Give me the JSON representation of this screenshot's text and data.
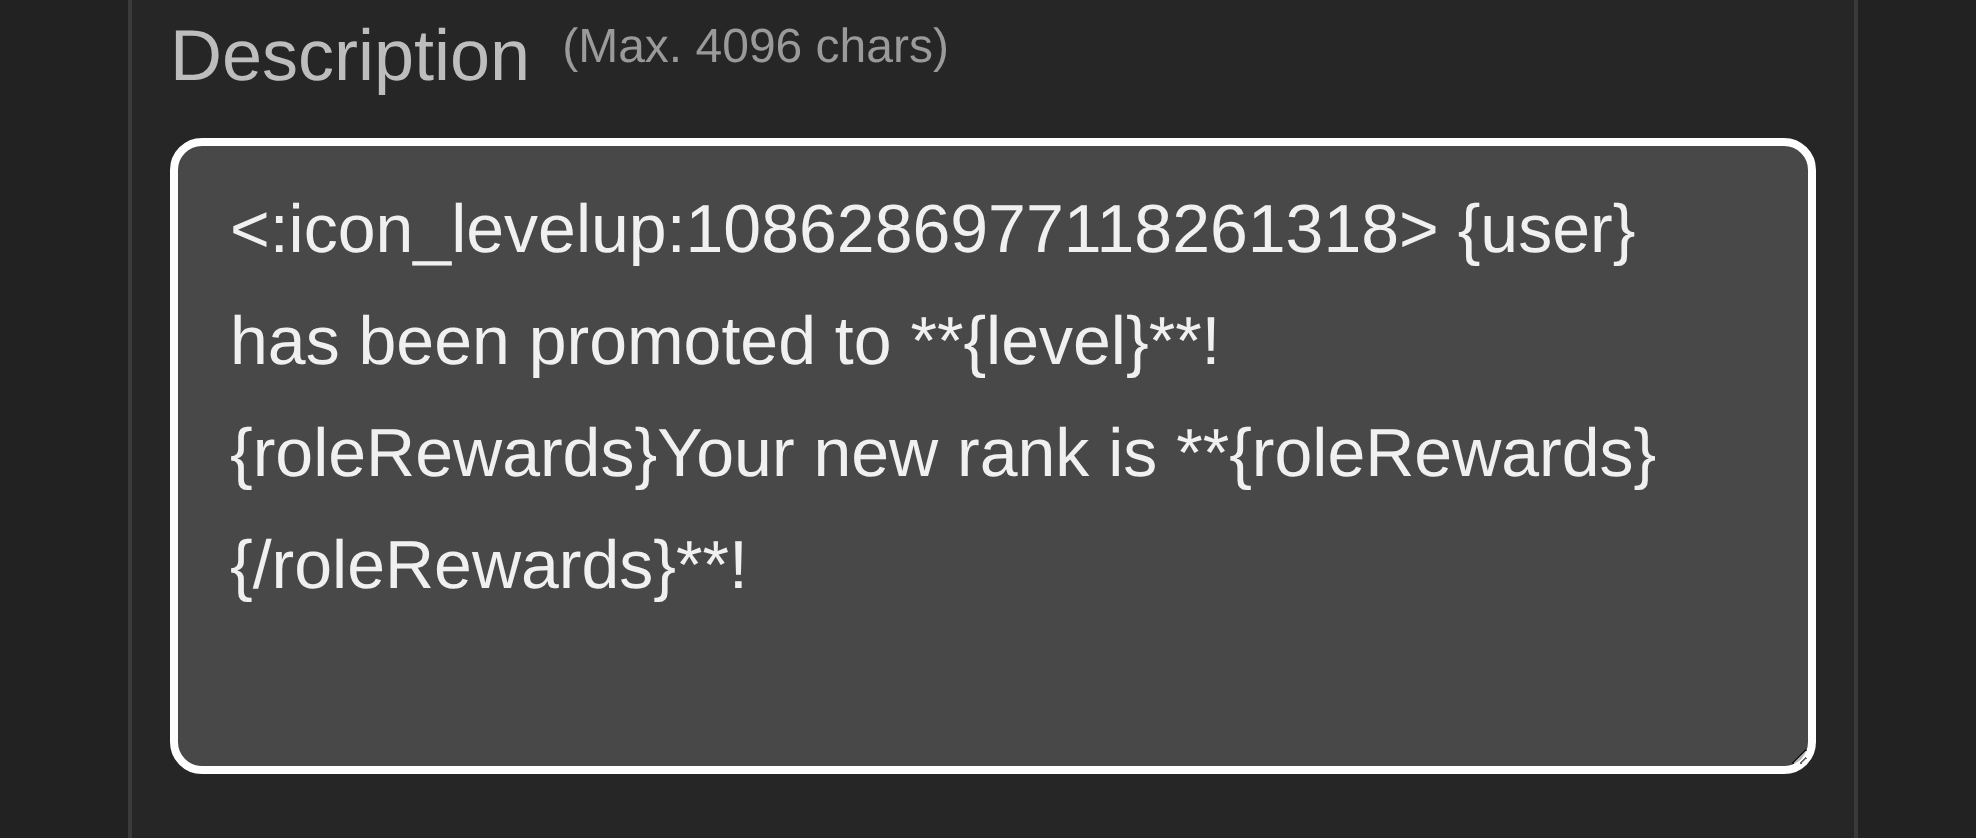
{
  "description_field": {
    "label": "Description",
    "hint": "(Max. 4096 chars)",
    "value": "<:icon_levelup:1086286977118261318> {user} has been promoted to **{level}**! {roleRewards}Your new rank is **{roleRewards}{/roleRewards}**!"
  }
}
